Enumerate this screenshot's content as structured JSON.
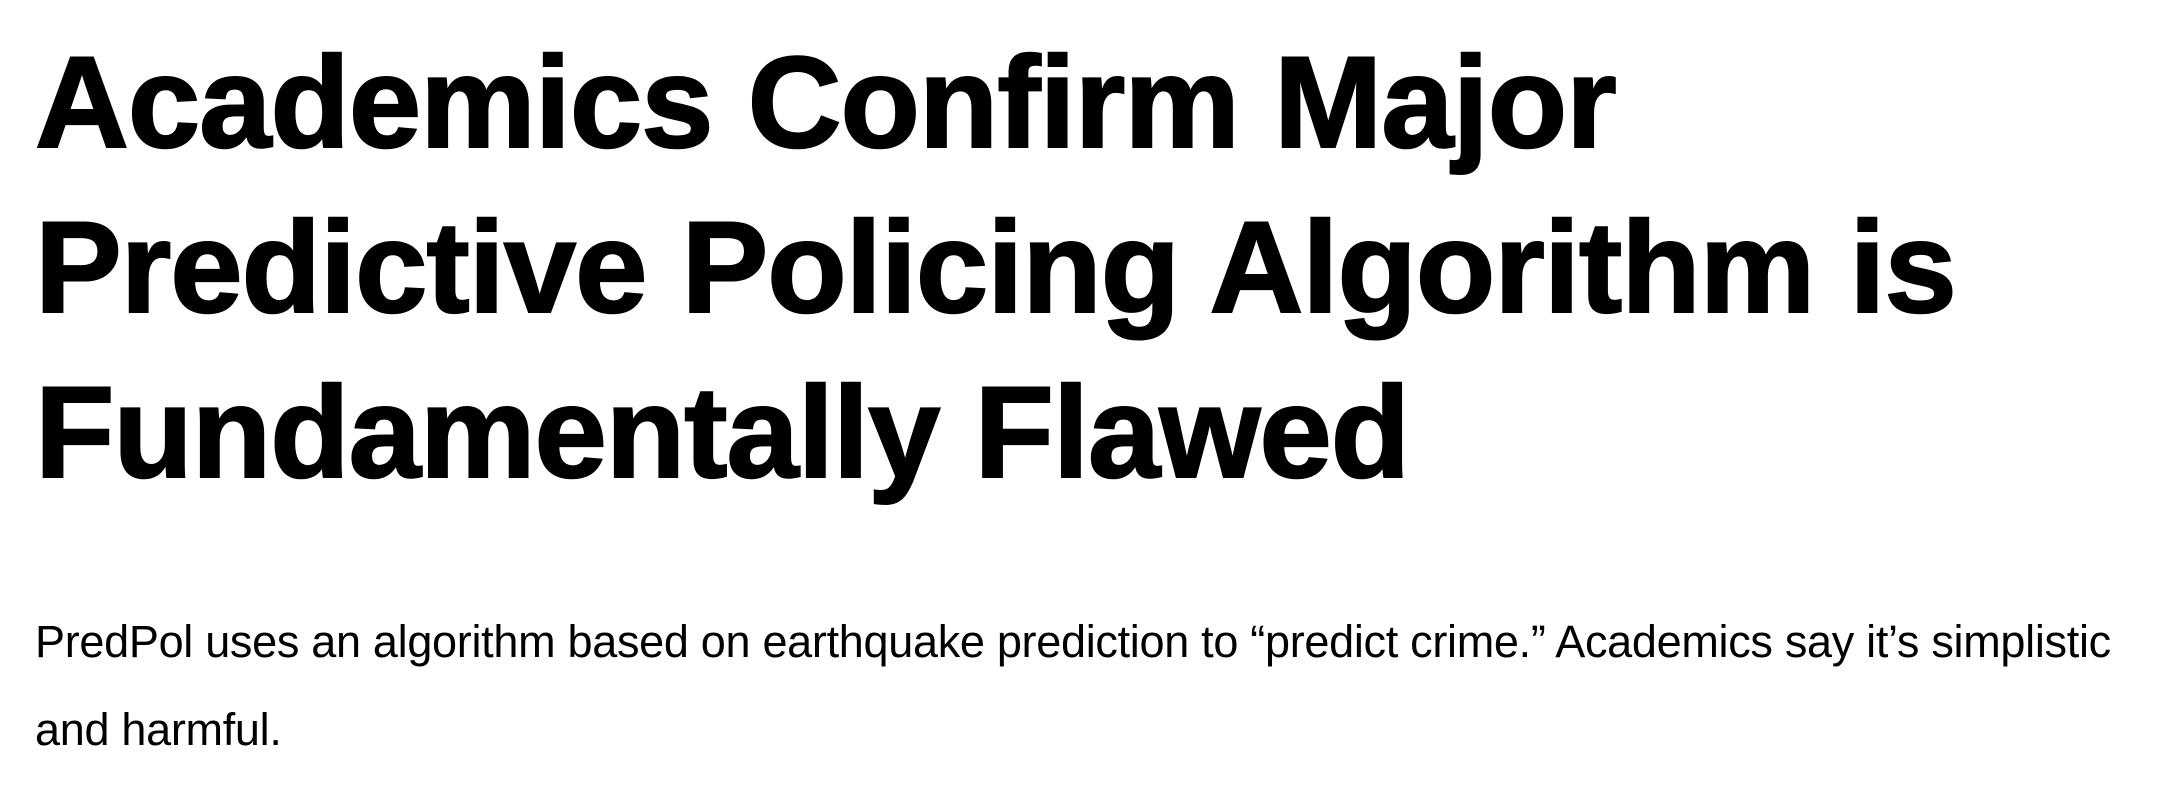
{
  "article": {
    "headline": "Academics Confirm Major Predictive Policing Algorithm is Fundamentally Flawed",
    "dek": "PredPol uses an algorithm based on earthquake prediction to “predict crime.” Academics say it’s simplistic and harmful."
  }
}
